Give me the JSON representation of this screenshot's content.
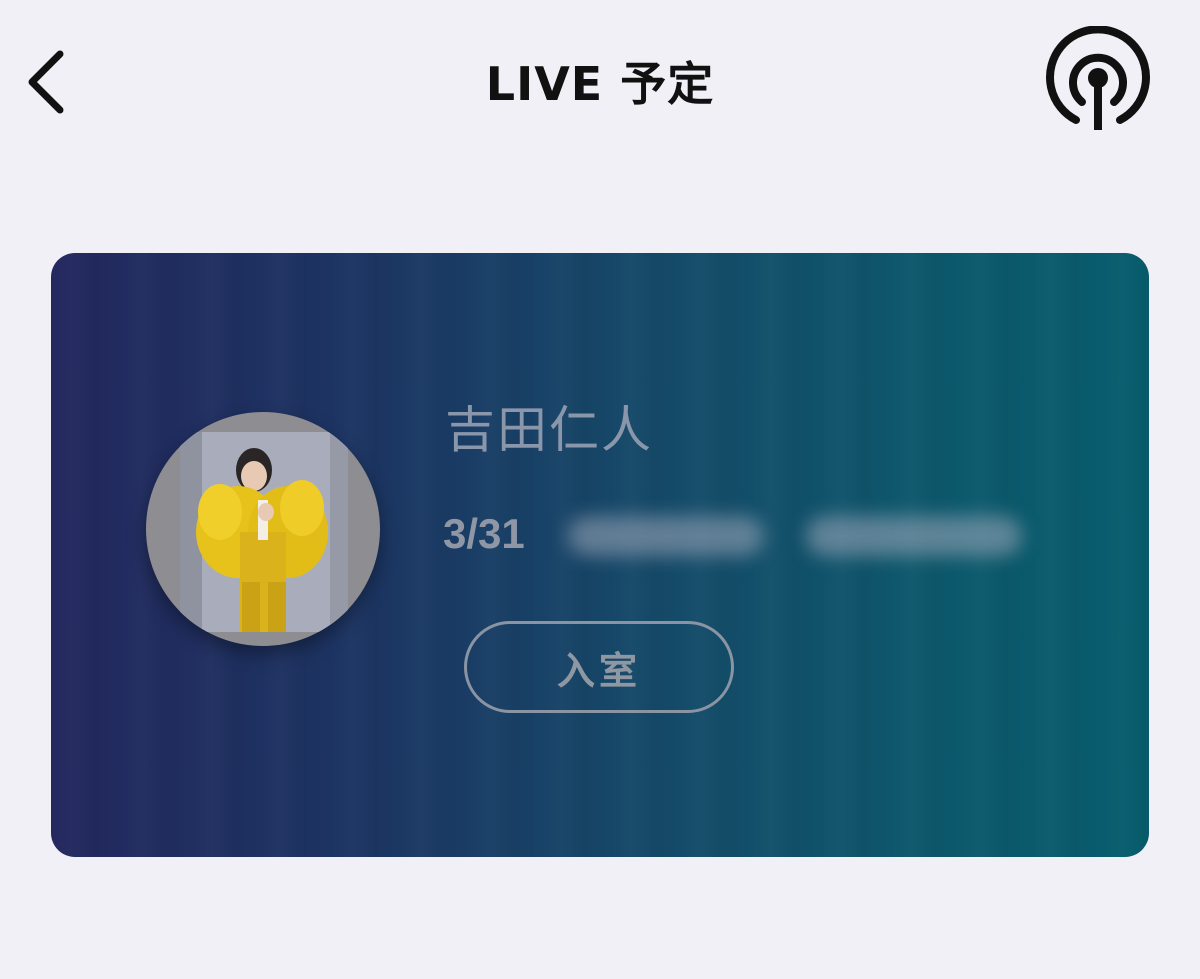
{
  "header": {
    "title": "LIVE 予定",
    "back_icon": "chevron-left-icon",
    "broadcast_icon": "broadcast-icon"
  },
  "live_card": {
    "streamer_name": "吉田仁人",
    "date": "3/31",
    "enter_label": "入室",
    "gradient_start": "#23285e",
    "gradient_end": "#075d6d"
  }
}
